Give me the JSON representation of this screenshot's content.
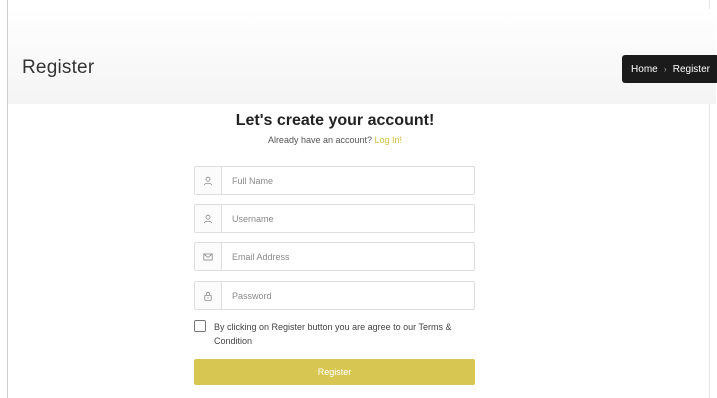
{
  "header": {
    "title": "Register",
    "breadcrumb": {
      "home": "Home",
      "separator": "›",
      "current": "Register"
    }
  },
  "form": {
    "heading": "Let's create your account!",
    "subtext_prefix": "Already have an account?",
    "login_link": "Log In!",
    "fields": [
      {
        "placeholder": "Full Name",
        "icon": "user-icon"
      },
      {
        "placeholder": "Username",
        "icon": "user-icon"
      },
      {
        "placeholder": "Email Address",
        "icon": "envelope-icon"
      },
      {
        "placeholder": "Password",
        "icon": "lock-icon"
      }
    ],
    "terms_label": "By clicking on Register button you are agree to our Terms & Condition",
    "submit_label": "Register"
  },
  "colors": {
    "accent": "#d8c653",
    "link": "#d4bf3f",
    "breadcrumb_bg": "#1b1b1b"
  }
}
